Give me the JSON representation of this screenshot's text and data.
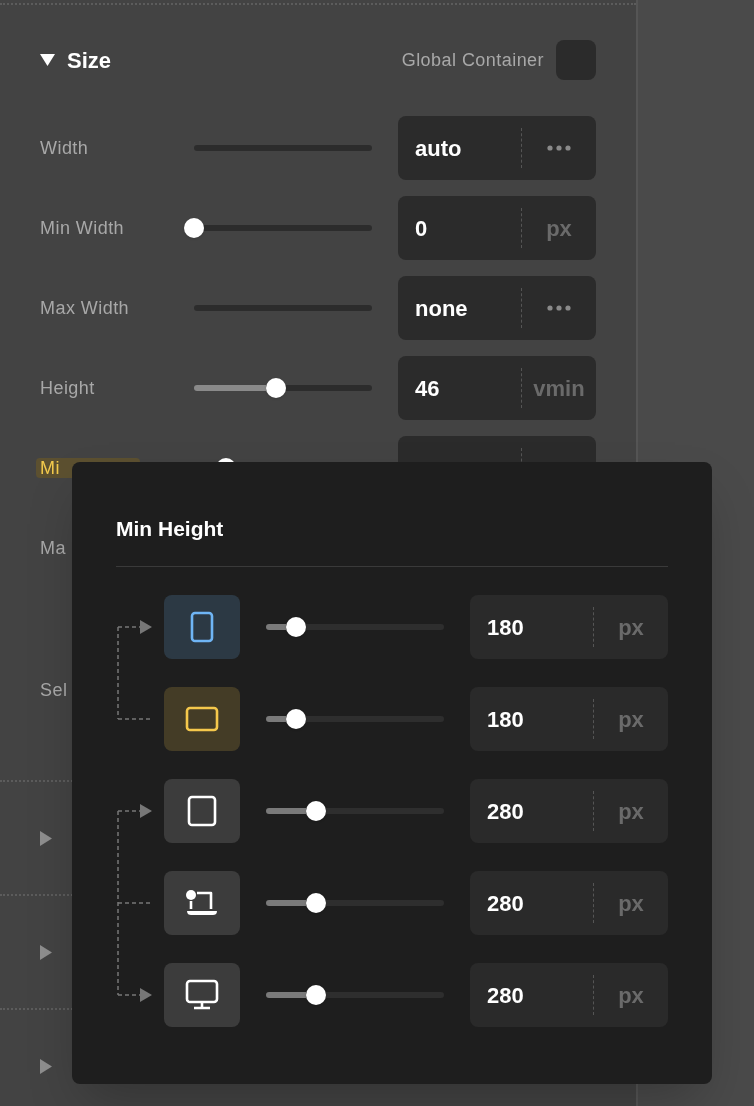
{
  "section": {
    "title": "Size",
    "expanded": true,
    "global_label": "Global Container",
    "global_checked": false
  },
  "rows": [
    {
      "label": "Width",
      "highlighted": false,
      "slider": {
        "kind": "plain"
      },
      "field": {
        "kind": "menu",
        "value": "auto"
      }
    },
    {
      "label": "Min Width",
      "highlighted": false,
      "slider": {
        "kind": "slider",
        "level": 0
      },
      "field": {
        "kind": "unit",
        "value": "0",
        "unit": "px"
      }
    },
    {
      "label": "Max Width",
      "highlighted": false,
      "slider": {
        "kind": "plain"
      },
      "field": {
        "kind": "menu",
        "value": "none"
      }
    },
    {
      "label": "Height",
      "highlighted": false,
      "slider": {
        "kind": "slider",
        "level": 0.46
      },
      "field": {
        "kind": "unit",
        "value": "46",
        "unit": "vmin"
      }
    },
    {
      "label": "Mi",
      "highlighted": true,
      "slider": {
        "kind": "thumb",
        "level": 0.18
      },
      "field": {
        "kind": "unit"
      }
    }
  ],
  "hidden_labels": [
    "Ma",
    "Sel"
  ],
  "collapsed_sections": [
    {
      "expanded": false
    },
    {
      "expanded": false
    },
    {
      "expanded": false
    }
  ],
  "popover": {
    "title": "Min Height",
    "groups": [
      {
        "rows": [
          {
            "device": {
              "kind": "tablet",
              "color": "#6fb5f5"
            },
            "connector": {
              "kind": "arrow"
            },
            "level": 0.17,
            "value": "180",
            "unit": "px"
          },
          {
            "device": {
              "kind": "landscape",
              "color": "#f5c84c"
            },
            "connector": {
              "kind": "line"
            },
            "level": 0.17,
            "value": "180",
            "unit": "px"
          }
        ]
      },
      {
        "rows": [
          {
            "device": {
              "kind": "square"
            },
            "connector": {
              "kind": "arrow"
            },
            "level": 0.28,
            "value": "280",
            "unit": "px"
          },
          {
            "device": {
              "kind": "laptop"
            },
            "connector": {
              "kind": "line"
            },
            "level": 0.28,
            "value": "280",
            "unit": "px"
          },
          {
            "device": {
              "kind": "desktop"
            },
            "connector": {
              "kind": "arrow"
            },
            "level": 0.28,
            "value": "280",
            "unit": "px"
          }
        ]
      }
    ]
  }
}
